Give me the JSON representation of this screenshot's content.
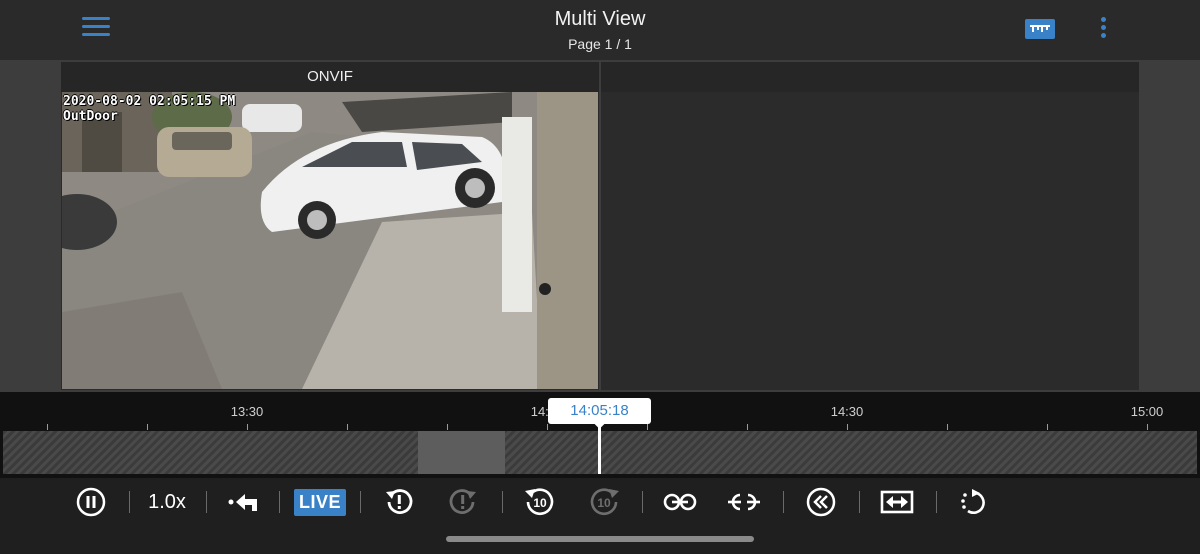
{
  "header": {
    "title": "Multi View",
    "subtitle": "Page 1 / 1",
    "menu_icon": "hamburger-menu-icon",
    "ruler_icon": "timeline-ruler-icon",
    "more_icon": "more-vertical-icon"
  },
  "tiles": [
    {
      "label": "ONVIF",
      "osd_timestamp": "2020-08-02 02:05:15 PM",
      "osd_name": "OutDoor"
    },
    {
      "label": ""
    }
  ],
  "timeline": {
    "current_time": "14:05:18",
    "tick_labels": [
      "13:30",
      "14:00",
      "14:30",
      "15:00"
    ]
  },
  "controls": {
    "pause_icon": "pause-icon",
    "speed": "1.0x",
    "back_icon": "reply-back-icon",
    "live_label": "LIVE",
    "alert_rewind_icon": "alert-rewind-icon",
    "alert_forward_icon": "alert-forward-icon",
    "rewind10_label": "10",
    "forward10_label": "10",
    "link_icon": "sync-link-icon",
    "unlink_icon": "sync-unlink-icon",
    "double_back_icon": "double-chevron-left-icon",
    "fit_icon": "fit-width-icon",
    "rotate_icon": "rotate-dotted-icon"
  },
  "colors": {
    "accent": "#3a82c8",
    "background": "#1f1f1f"
  }
}
